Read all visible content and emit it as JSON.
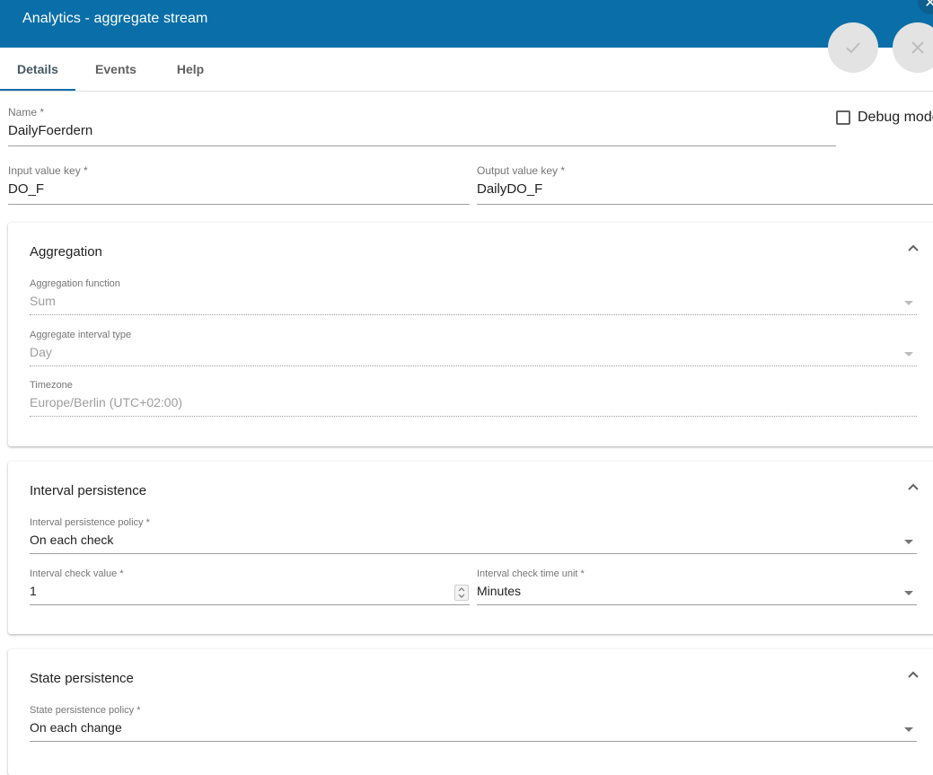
{
  "header": {
    "title": "Analytics - aggregate stream"
  },
  "tabs": [
    {
      "label": "Details",
      "active": true
    },
    {
      "label": "Events",
      "active": false
    },
    {
      "label": "Help",
      "active": false
    }
  ],
  "form": {
    "name": {
      "label": "Name *",
      "value": "DailyFoerdern"
    },
    "debug_mode": {
      "label": "Debug mode",
      "checked": false
    },
    "input_key": {
      "label": "Input value key *",
      "value": "DO_F"
    },
    "output_key": {
      "label": "Output value key *",
      "value": "DailyDO_F"
    }
  },
  "aggregation": {
    "title": "Aggregation",
    "function": {
      "label": "Aggregation function",
      "value": "Sum"
    },
    "interval_type": {
      "label": "Aggregate interval type",
      "value": "Day"
    },
    "timezone": {
      "label": "Timezone",
      "value": "Europe/Berlin (UTC+02:00)"
    }
  },
  "interval_persistence": {
    "title": "Interval persistence",
    "policy": {
      "label": "Interval persistence policy *",
      "value": "On each check"
    },
    "check_value": {
      "label": "Interval check value *",
      "value": "1"
    },
    "time_unit": {
      "label": "Interval check time unit *",
      "value": "Minutes"
    }
  },
  "state_persistence": {
    "title": "State persistence",
    "policy": {
      "label": "State persistence policy *",
      "value": "On each change"
    }
  },
  "colors": {
    "header": "#0a6fa8",
    "accent": "#0a6fa8"
  }
}
